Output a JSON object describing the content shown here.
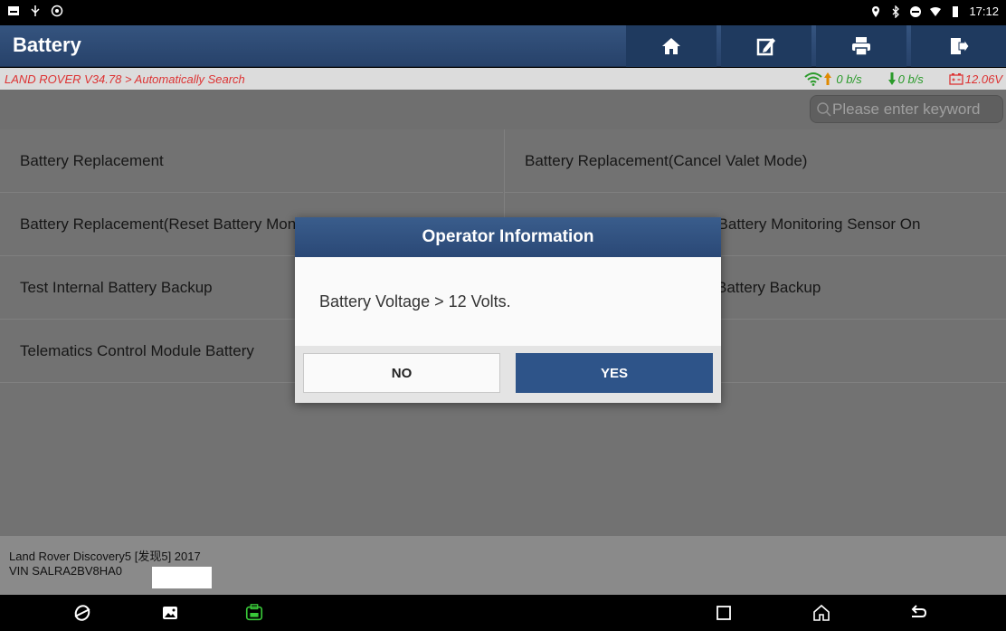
{
  "status_bar": {
    "time": "17:12",
    "left_icons": [
      "notification-icon",
      "usb-icon",
      "settings-app-icon"
    ],
    "right_icons": [
      "location-icon",
      "bluetooth-icon",
      "dnd-icon",
      "wifi-icon",
      "battery-icon"
    ]
  },
  "header": {
    "title": "Battery",
    "buttons": [
      "home-icon",
      "edit-icon",
      "print-icon",
      "exit-icon"
    ]
  },
  "breadcrumb": {
    "path": "LAND ROVER V34.78 > Automatically Search",
    "upload_rate": "0 b/s",
    "download_rate": "0 b/s",
    "voltage": "12.06V"
  },
  "search": {
    "placeholder": "Please enter keyword"
  },
  "functions": [
    "Battery Replacement",
    "Battery Replacement(Cancel Valet Mode)",
    "Battery Replacement(Reset Battery Monitoring Sensor On Battery #1)",
    "Battery Replacement(Reset Battery Monitoring Sensor On",
    "Test Internal Battery Backup",
    "Battery Backup",
    "Telematics Control Module Battery"
  ],
  "vehicle": {
    "model": "Land Rover Discovery5 [发现5] 2017",
    "vin": "VIN SALRA2BV8HA0"
  },
  "dialog": {
    "title": "Operator Information",
    "message": "Battery Voltage > 12 Volts.",
    "no_label": "NO",
    "yes_label": "YES"
  },
  "colors": {
    "header_blue": "#2a4876",
    "accent_red": "#dd3333",
    "accent_green": "#2a9a2a",
    "yes_button": "#2e5489"
  }
}
